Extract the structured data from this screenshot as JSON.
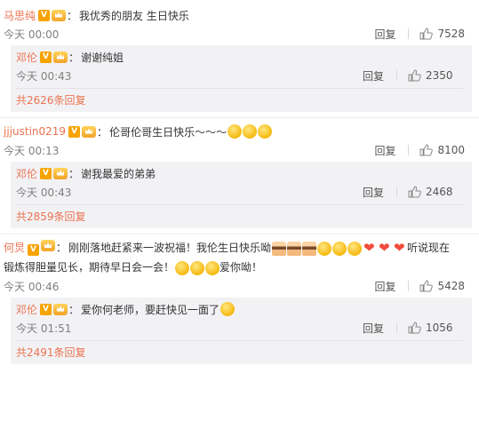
{
  "comments": [
    {
      "user": "马思纯",
      "text": "我优秀的朋友 生日快乐",
      "time": "今天 00:00",
      "reply_label": "回复",
      "likes": "7528",
      "reply": {
        "user": "邓伦",
        "text": "谢谢纯姐",
        "time": "今天 00:43",
        "reply_label": "回复",
        "likes": "2350"
      },
      "reply_count": "共2626条回复"
    },
    {
      "user": "jjjustin0219",
      "text": "伦哥伦哥生日快乐～～～",
      "time": "今天 00:13",
      "reply_label": "回复",
      "likes": "8100",
      "reply": {
        "user": "邓伦",
        "text": "谢我最爱的弟弟",
        "time": "今天 00:43",
        "reply_label": "回复",
        "likes": "2468"
      },
      "reply_count": "共2859条回复"
    },
    {
      "user": "何炅",
      "text_a": "刚刚落地赶紧来一波祝福！我伦生日快乐呦",
      "text_b": "听说现在",
      "text_c": "锻炼得胆量见长，期待早日会一会！",
      "text_d": "爱你呦！",
      "time": "今天 00:46",
      "reply_label": "回复",
      "likes": "5428",
      "reply": {
        "user": "邓伦",
        "text": "爱你何老师，要赶快见一面了",
        "time": "今天 01:51",
        "reply_label": "回复",
        "likes": "1056"
      },
      "reply_count": "共2491条回复"
    }
  ],
  "badges": {
    "v": "V"
  },
  "colors": {
    "username": "#eb7350",
    "reply_bg": "#f2f2f5",
    "meta": "#808080"
  },
  "icons": {
    "like": "thumbs-up-icon",
    "verified": "verified-v-icon",
    "member": "crown-member-icon"
  }
}
